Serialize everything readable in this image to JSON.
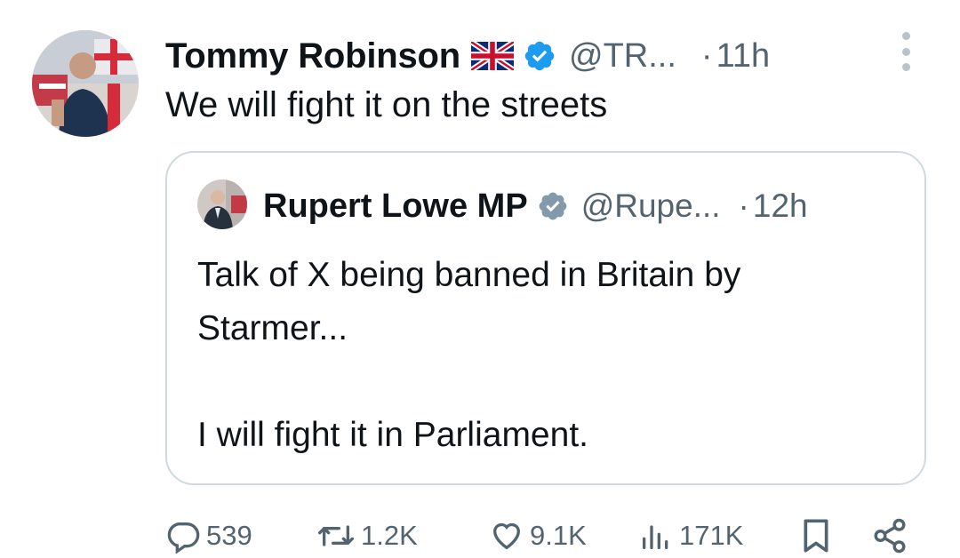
{
  "tweet": {
    "author_name": "Tommy Robinson",
    "handle": "@TR...",
    "separator": "·",
    "time": "11h",
    "text": "We will fight it on the streets",
    "flag_icon": "union-jack-flag-icon",
    "verified_icon": "verified-badge-icon",
    "verified_color": "#1d9bf0"
  },
  "quote": {
    "author_name": "Rupert Lowe MP",
    "handle": "@Rupe...",
    "separator": "·",
    "time": "12h",
    "verified_icon": "verified-badge-icon",
    "verified_color": "#829aab",
    "paragraphs": [
      "Talk of X being banned in Britain by Starmer...",
      "I will fight it in Parliament."
    ]
  },
  "actions": {
    "replies": "539",
    "reposts": "1.2K",
    "likes": "9.1K",
    "views": "171K",
    "icons": [
      "reply-icon",
      "repost-icon",
      "like-icon",
      "views-icon",
      "bookmark-icon",
      "share-icon"
    ]
  },
  "colors": {
    "text": "#0f1419",
    "secondary": "#536471",
    "border": "#cfd9de"
  }
}
